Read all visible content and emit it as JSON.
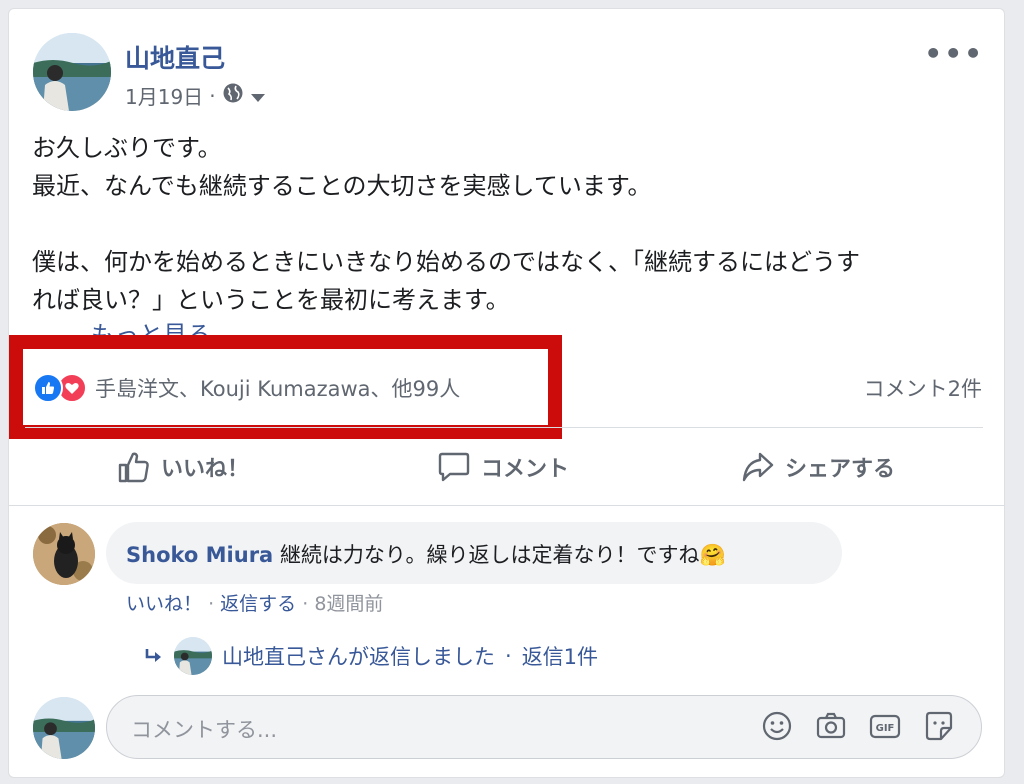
{
  "post": {
    "author": "山地直己",
    "date": "1月19日",
    "date_separator": "·",
    "privacy_icon": "globe-icon",
    "text_lines": [
      "お久しぶりです。",
      "最近、なんでも継続することの大切さを実感しています。",
      "",
      "僕は、何かを始めるときにいきなり始めるのではなく、「継続するにはどうす",
      "れば良い？」ということを最初に考えます。"
    ],
    "see_more": "もっと見る"
  },
  "reactions": {
    "summary": "手島洋文、Kouji Kumazawa、他99人",
    "comment_count": "コメント2件",
    "highlight_color": "#cc0b0b"
  },
  "actions": {
    "like": "いいね！",
    "comment": "コメント",
    "share": "シェアする"
  },
  "comment": {
    "author": "Shoko Miura",
    "text": "継続は力なり。繰り返しは定着なり！ですね🤗",
    "like": "いいね！",
    "separator": "·",
    "reply": "返信する",
    "time": "8週間前"
  },
  "reply_summary": {
    "text": "山地直己さんが返信しました",
    "separator": "·",
    "count": "返信1件"
  },
  "composer": {
    "placeholder": "コメントする..."
  },
  "colors": {
    "link": "#385898",
    "muted": "#606770",
    "like_blue": "#1877f2",
    "love_red": "#f33e58"
  }
}
